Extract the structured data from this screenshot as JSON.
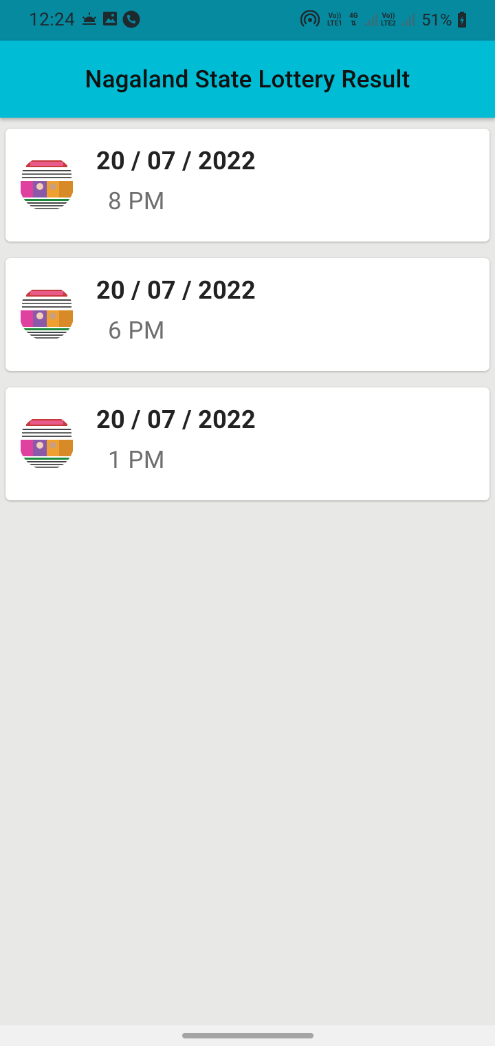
{
  "status_bar": {
    "time": "12:24",
    "icons": [
      "weather-sunrise-icon",
      "gallery-icon",
      "phone-call-icon",
      "hotspot-icon",
      "signal-icon",
      "battery-icon"
    ],
    "sim1_top": "Vo))",
    "sim1_bottom": "LTE1",
    "net_type": "4G",
    "sim2_top": "Vo))",
    "sim2_bottom": "LTE2",
    "battery_percent": "51%",
    "battery_level": 0.51,
    "color": "#068aa0"
  },
  "app_bar": {
    "title": "Nagaland State Lottery Result",
    "color": "#00bcd4"
  },
  "results": [
    {
      "date": "20 / 07 / 2022",
      "time": "8 PM",
      "thumb_icon": "lottery-ticket-thumbnail"
    },
    {
      "date": "20 / 07 / 2022",
      "time": "6 PM",
      "thumb_icon": "lottery-ticket-thumbnail"
    },
    {
      "date": "20 / 07 / 2022",
      "time": "1 PM",
      "thumb_icon": "lottery-ticket-thumbnail"
    }
  ],
  "colors": {
    "background": "#e8e9e7",
    "card": "#ffffff",
    "date_text": "#222222",
    "time_text": "#6e6e6e"
  }
}
